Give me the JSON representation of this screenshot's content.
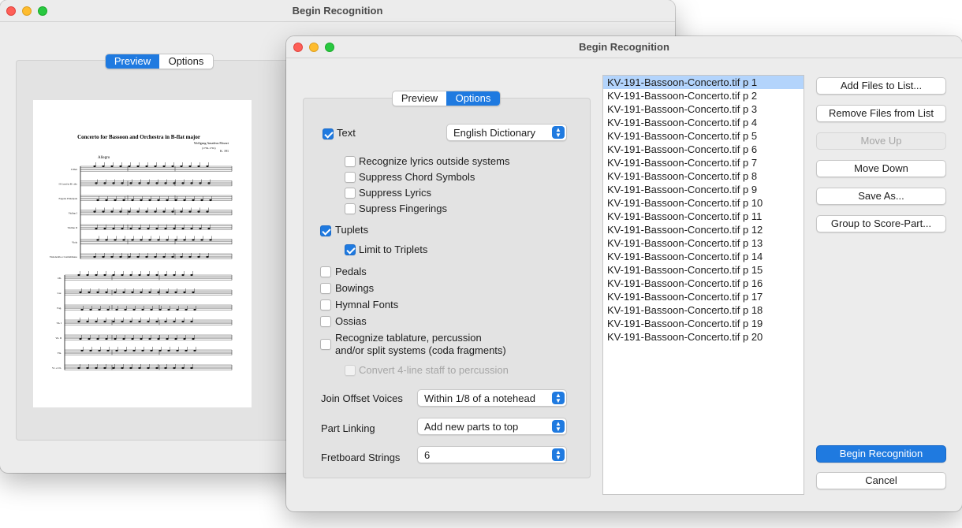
{
  "back_window": {
    "title": "Begin Recognition",
    "tabs": [
      "Preview",
      "Options"
    ],
    "score": {
      "title": "Concerto for Bassoon and Orchestra in B-flat major",
      "composer": "Wolfgang Amadeus Mozart",
      "dates": "(1756-1791)",
      "catalog": "K. 191",
      "tempo": "Allegro",
      "system1_staves": [
        "I Oboi",
        "II Corni in B♭ alto",
        "Fagotto Principale",
        "Violino I",
        "Violino II",
        "Viola",
        "Violoncello e Contrabbasso"
      ],
      "system2_staves": [
        "Ob.",
        "Cor.",
        "Fag.",
        "Vn. I",
        "Vn. II",
        "Vla.",
        "Vc. e Cb."
      ]
    }
  },
  "front_window": {
    "title": "Begin Recognition",
    "tabs": [
      "Preview",
      "Options"
    ],
    "options": {
      "text_label": "Text",
      "dictionary": "English Dictionary",
      "recognize_lyrics": "Recognize lyrics outside systems",
      "suppress_chords": "Suppress Chord Symbols",
      "suppress_lyrics": "Suppress Lyrics",
      "suppress_fingerings": "Supress Fingerings",
      "tuplets": "Tuplets",
      "limit_triplets": "Limit to Triplets",
      "pedals": "Pedals",
      "bowings": "Bowings",
      "hymnal": "Hymnal Fonts",
      "ossias": "Ossias",
      "tab_line1": "Recognize tablature, percussion",
      "tab_line2": "and/or split systems (coda fragments)",
      "convert4": "Convert 4-line staff to percussion",
      "join_offset_label": "Join Offset Voices",
      "join_offset_value": "Within 1/8 of a notehead",
      "part_linking_label": "Part Linking",
      "part_linking_value": "Add new parts to top",
      "fretboard_label": "Fretboard Strings",
      "fretboard_value": "6"
    },
    "files": [
      "KV-191-Bassoon-Concerto.tif p  1",
      "KV-191-Bassoon-Concerto.tif p  2",
      "KV-191-Bassoon-Concerto.tif p  3",
      "KV-191-Bassoon-Concerto.tif p  4",
      "KV-191-Bassoon-Concerto.tif p  5",
      "KV-191-Bassoon-Concerto.tif p  6",
      "KV-191-Bassoon-Concerto.tif p  7",
      "KV-191-Bassoon-Concerto.tif p  8",
      "KV-191-Bassoon-Concerto.tif p  9",
      "KV-191-Bassoon-Concerto.tif p 10",
      "KV-191-Bassoon-Concerto.tif p 11",
      "KV-191-Bassoon-Concerto.tif p 12",
      "KV-191-Bassoon-Concerto.tif p 13",
      "KV-191-Bassoon-Concerto.tif p 14",
      "KV-191-Bassoon-Concerto.tif p 15",
      "KV-191-Bassoon-Concerto.tif p 16",
      "KV-191-Bassoon-Concerto.tif p 17",
      "KV-191-Bassoon-Concerto.tif p 18",
      "KV-191-Bassoon-Concerto.tif p 19",
      "KV-191-Bassoon-Concerto.tif p 20"
    ],
    "buttons": {
      "add_files": "Add Files to List...",
      "remove_files": "Remove Files from List",
      "move_up": "Move Up",
      "move_down": "Move Down",
      "save_as": "Save As...",
      "group": "Group to Score-Part...",
      "begin": "Begin Recognition",
      "cancel": "Cancel"
    }
  },
  "colors": {
    "accent": "#1f7ae0",
    "selection": "#b3d4fc",
    "window_bg": "#ececec"
  }
}
